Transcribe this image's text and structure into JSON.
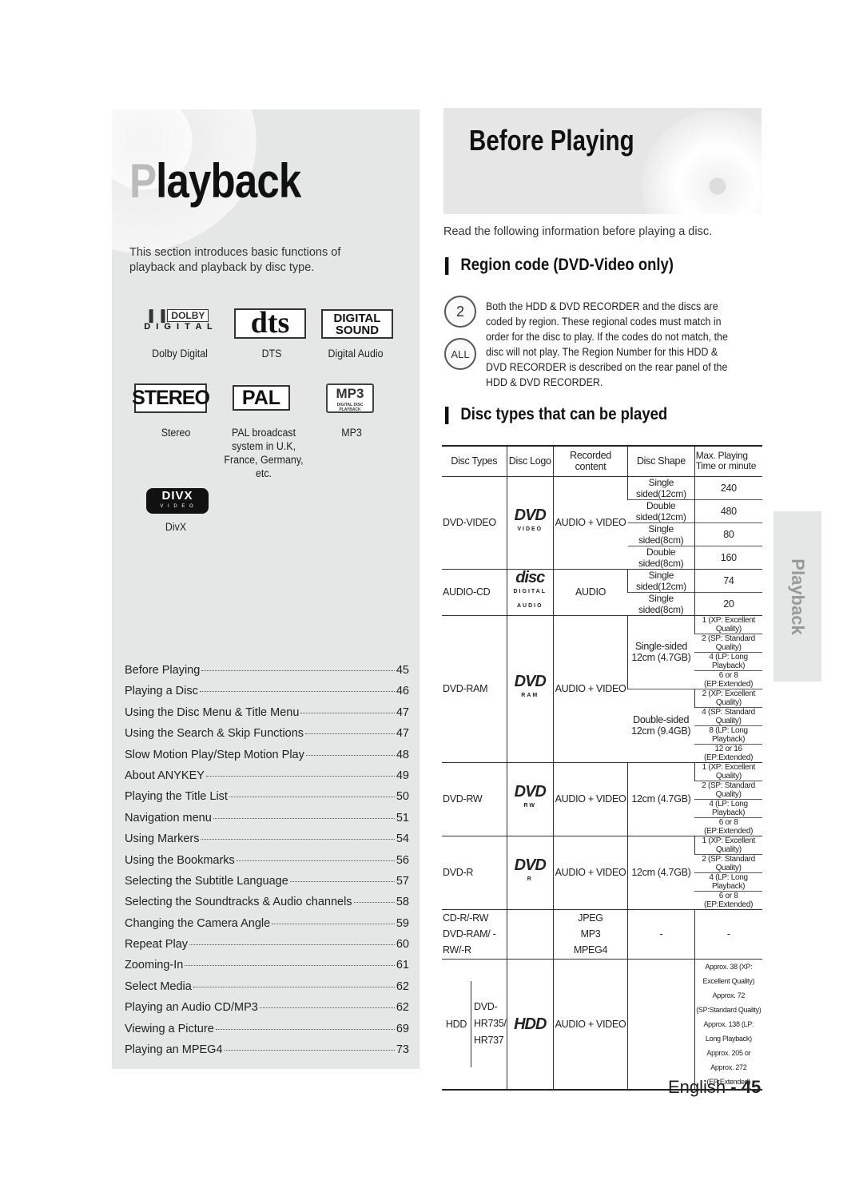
{
  "left": {
    "title_first": "P",
    "title_rest": "layback",
    "intro": "This section introduces basic functions of playback and playback by disc type.",
    "logos": [
      {
        "name": "dolby",
        "caption": "Dolby Digital",
        "text": "DOLBY",
        "subtext": "D I G I T A L"
      },
      {
        "name": "dts",
        "caption": "DTS",
        "text": "dts"
      },
      {
        "name": "digital-sound",
        "caption": "Digital Audio",
        "text": "DIGITAL SOUND"
      },
      {
        "name": "stereo",
        "caption": "Stereo",
        "text": "STEREO"
      },
      {
        "name": "pal",
        "caption": "PAL broadcast system in U.K, France, Germany, etc.",
        "text": "PAL"
      },
      {
        "name": "mp3",
        "caption": "MP3",
        "text": "MP3",
        "subtext": "DIGITAL DISC PLAYBACK"
      },
      {
        "name": "divx",
        "caption": "DivX",
        "text": "DIVX",
        "subtext": "V I D E O"
      }
    ],
    "toc": [
      {
        "label": "Before Playing",
        "page": "45"
      },
      {
        "label": "Playing a Disc",
        "page": "46"
      },
      {
        "label": "Using the Disc Menu & Title Menu",
        "page": "47"
      },
      {
        "label": "Using the Search & Skip Functions",
        "page": "47"
      },
      {
        "label": "Slow Motion Play/Step Motion Play",
        "page": "48"
      },
      {
        "label": "About ANYKEY",
        "page": "49"
      },
      {
        "label": "Playing the Title List",
        "page": "50"
      },
      {
        "label": "Navigation menu",
        "page": "51"
      },
      {
        "label": "Using Markers",
        "page": "54"
      },
      {
        "label": "Using the Bookmarks",
        "page": "56"
      },
      {
        "label": "Selecting the Subtitle Language",
        "page": "57"
      },
      {
        "label": "Selecting the Soundtracks & Audio channels",
        "page": "58"
      },
      {
        "label": "Changing the Camera Angle",
        "page": "59"
      },
      {
        "label": "Repeat Play",
        "page": "60"
      },
      {
        "label": "Zooming-In",
        "page": "61"
      },
      {
        "label": "Select Media",
        "page": "62"
      },
      {
        "label": "Playing an Audio CD/MP3",
        "page": "62"
      },
      {
        "label": "Viewing a Picture",
        "page": "69"
      },
      {
        "label": "Playing an MPEG4",
        "page": "73"
      }
    ]
  },
  "right": {
    "title": "Before Playing",
    "read_line": "Read the following information before playing a disc.",
    "region_heading": "Region code (DVD-Video only)",
    "region_icons": [
      "2",
      "ALL"
    ],
    "region_text": "Both the HDD & DVD RECORDER and the discs are coded by region. These regional codes must match in order for the disc to play. If the codes do not match, the disc will not play. The Region Number for this HDD & DVD RECORDER is described on the rear panel of the HDD & DVD RECORDER.",
    "disc_heading": "Disc types that can be played",
    "table": {
      "headers": [
        "Disc Types",
        "Disc Logo",
        "Recorded content",
        "Disc Shape",
        "Max. Playing Time or minute"
      ],
      "dvd_video": {
        "type": "DVD-VIDEO",
        "logo": "DVD",
        "logo_sub": "VIDEO",
        "content": "AUDIO + VIDEO",
        "rows": [
          [
            "Single sided(12cm)",
            "240"
          ],
          [
            "Double sided(12cm)",
            "480"
          ],
          [
            "Single sided(8cm)",
            "80"
          ],
          [
            "Double sided(8cm)",
            "160"
          ]
        ]
      },
      "audio_cd": {
        "type": "AUDIO-CD",
        "logo": "disc",
        "logo_sub": "DIGITAL AUDIO",
        "content": "AUDIO",
        "rows": [
          [
            "Single sided(12cm)",
            "74"
          ],
          [
            "Single sided(8cm)",
            "20"
          ]
        ]
      },
      "dvd_ram": {
        "type": "DVD-RAM",
        "logo": "DVD",
        "logo_sub": "RAM",
        "content": "AUDIO + VIDEO",
        "shapes": [
          {
            "shape": "Single-sided 12cm (4.7GB)",
            "times": [
              "1 (XP: Excellent Quality)",
              "2 (SP: Standard Quality)",
              "4 (LP: Long Playback)",
              "6 or 8 (EP:Extended)"
            ]
          },
          {
            "shape": "Double-sided 12cm (9.4GB)",
            "times": [
              "2 (XP: Excellent Quality)",
              "4 (SP: Standard Quality)",
              "8 (LP: Long Playback)",
              "12 or 16 (EP:Extended)"
            ]
          }
        ]
      },
      "dvd_rw": {
        "type": "DVD-RW",
        "logo": "DVD",
        "logo_sub": "RW",
        "content": "AUDIO + VIDEO",
        "shape": "12cm (4.7GB)",
        "times": [
          "1 (XP: Excellent Quality)",
          "2 (SP: Standard Quality)",
          "4 (LP: Long Playback)",
          "6 or 8 (EP:Extended)"
        ]
      },
      "dvd_r": {
        "type": "DVD-R",
        "logo": "DVD",
        "logo_sub": "R",
        "content": "AUDIO + VIDEO",
        "shape": "12cm (4.7GB)",
        "times": [
          "1 (XP: Excellent Quality)",
          "2 (SP: Standard Quality)",
          "4 (LP: Long Playback)",
          "6 or 8 (EP:Extended)"
        ]
      },
      "cdr": {
        "type": "CD-R/-RW DVD-RAM/ -RW/-R",
        "content": "JPEG MP3 MPEG4",
        "shape": "-",
        "time": "-"
      },
      "hdd": {
        "type": "HDD",
        "model": "DVD- HR735/ HR737",
        "logo": "HDD",
        "content": "AUDIO + VIDEO",
        "times": [
          "Approx. 38 (XP: Excellent Quality)",
          "Approx. 72 (SP:Standard Quality)",
          "Approx. 138 (LP: Long Playback)",
          "Approx. 205 or Approx. 272",
          "(EP:Extended)"
        ]
      }
    }
  },
  "side_tab": "Playback",
  "footer": {
    "lang": "English",
    "sep": " - ",
    "page": "45"
  }
}
